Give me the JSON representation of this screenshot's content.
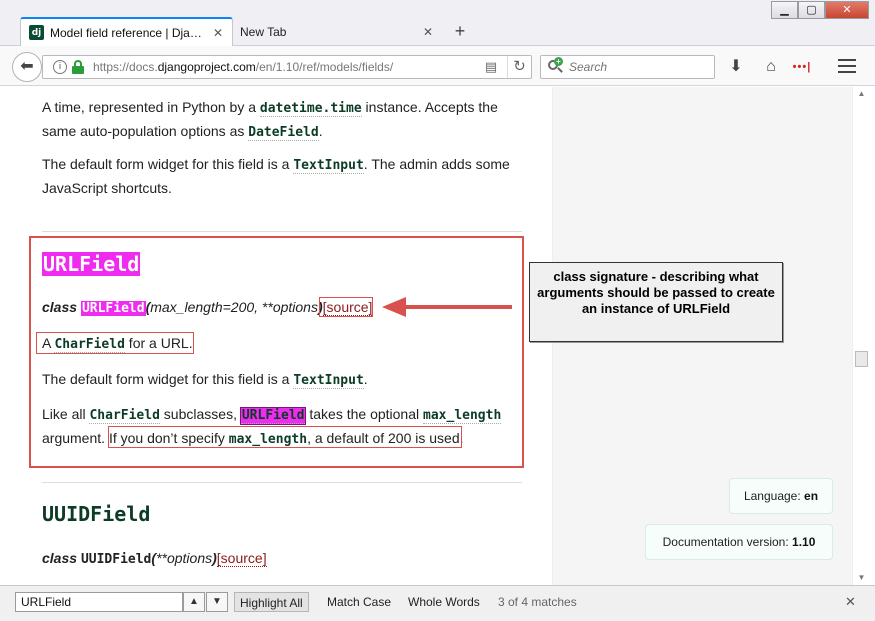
{
  "browser": {
    "tabs": [
      {
        "favicon_text": "dj",
        "title": "Model field reference | Dja…",
        "active": true
      },
      {
        "title": "New Tab",
        "active": false
      }
    ],
    "tab_close_glyph": "✕",
    "new_tab_glyph": "+",
    "window_controls": {
      "minimize": "▁",
      "maximize": "▢",
      "close": "✕"
    },
    "url": {
      "prefix": "https://docs.",
      "host": "djangoproject.com",
      "path": "/en/1.10/ref/models/fields/"
    },
    "search_placeholder": "Search",
    "toolbar_icons": {
      "download": "⬇",
      "home": "⌂",
      "lastpass": "•••|"
    }
  },
  "page": {
    "intro_para1": [
      {
        "t": "A time, represented in Python by a "
      },
      {
        "c": "datetime.time"
      },
      {
        "t": " instance. Accepts the same auto-population options as "
      },
      {
        "c": "DateField"
      },
      {
        "t": "."
      }
    ],
    "intro_para2": [
      {
        "t": "The default form widget for this field is a "
      },
      {
        "c": "TextInput"
      },
      {
        "t": ". The admin adds some JavaScript shortcuts."
      }
    ],
    "urlfield": {
      "title": "URLField",
      "sig_class": "class",
      "sig_name": "URLField",
      "sig_params": "max_length=200, **options",
      "source_label": "[source]",
      "desc_prefix": "A ",
      "desc_code": "CharField",
      "desc_suffix": " for a URL.",
      "widget_prefix": "The default form widget for this field is a ",
      "widget_code": "TextInput",
      "widget_suffix": ".",
      "like_prefix": "Like all ",
      "like_code": "CharField",
      "like_mid": " subclasses, ",
      "like_highlight": "URLField",
      "like_after": " takes the optional ",
      "like_code2": "max_length",
      "like_line2_prefix": "argument. ",
      "like_boxed_prefix": "If you don’t specify ",
      "like_boxed_code": "max_length",
      "like_boxed_suffix": ", a default of 200 is used."
    },
    "uuidfield": {
      "title": "UUIDField",
      "sig_class": "class",
      "sig_name": "UUIDField",
      "sig_params": "**options",
      "source_label": "[source]"
    },
    "callout_text": "class signature - describing what arguments should be passed to create an instance of URLField",
    "language_label": "Language:",
    "language_value": "en",
    "version_label": "Documentation version:",
    "version_value": "1.10"
  },
  "findbar": {
    "query": "URLField",
    "prev_glyph": "▲",
    "next_glyph": "▼",
    "highlight_all": "Highlight All",
    "match_case": "Match Case",
    "whole_words": "Whole Words",
    "status": "3 of 4 matches",
    "close_glyph": "✕"
  },
  "colors": {
    "highlight": "#ef2bef",
    "annotation_red": "#d9514c",
    "django_green": "#0c3c26"
  }
}
